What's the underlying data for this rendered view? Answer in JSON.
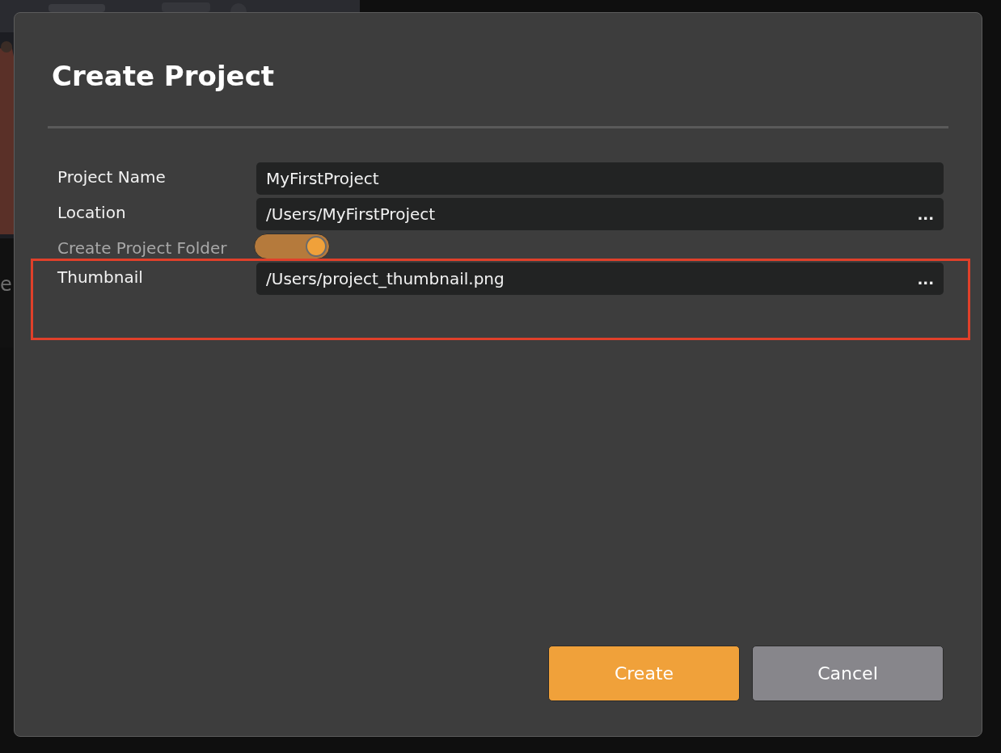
{
  "background": {
    "kind": "picture",
    "text": "e"
  },
  "dialog": {
    "title": "Create Project",
    "rows": [
      {
        "kind": "text",
        "label": "Project Name",
        "value": "MyFirstProject"
      },
      {
        "kind": "browse",
        "label": "Location",
        "value": "/Users/MyFirstProject",
        "browse": "..."
      },
      {
        "kind": "toggle",
        "label": "Create Project Folder",
        "on": true
      },
      {
        "kind": "browse",
        "label": "Thumbnail",
        "value": "/Users/project_thumbnail.png",
        "browse": "..."
      }
    ],
    "buttons": [
      {
        "label": "Create",
        "kind": "primary"
      },
      {
        "label": "Cancel",
        "kind": "secondary"
      }
    ]
  }
}
